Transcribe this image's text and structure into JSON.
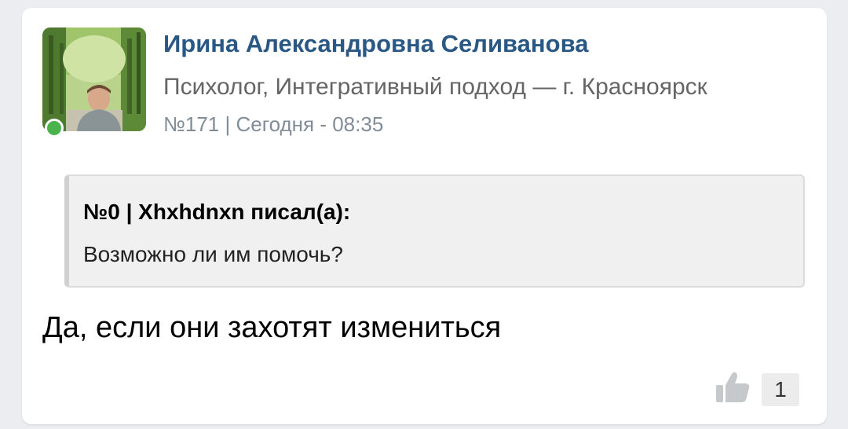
{
  "post": {
    "author": {
      "name": "Ирина Александровна Селиванова",
      "role": "Психолог, Интегративный подход — г. Красноярск",
      "online": true
    },
    "meta": "№171 | Сегодня - 08:35",
    "quote": {
      "header": "№0 | Xhxhdnxn писал(а):",
      "text": "Возможно ли им помочь?"
    },
    "message": "Да, если они захотят измениться",
    "likes": {
      "icon": "thumbs-up-icon",
      "count": "1"
    }
  },
  "colors": {
    "name": "#2a5885",
    "online": "#4bb34b",
    "meta": "#818c99"
  }
}
